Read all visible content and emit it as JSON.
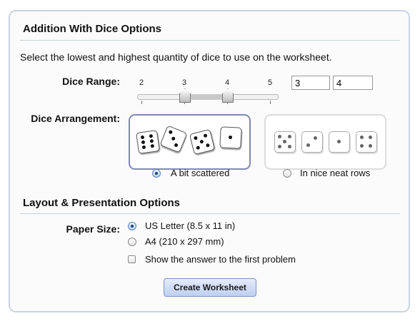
{
  "dice_section": {
    "title": "Addition With Dice Options",
    "intro": "Select the lowest and highest quantity of dice to use on the worksheet.",
    "range": {
      "label": "Dice Range:",
      "ticks": [
        "2",
        "3",
        "4",
        "5"
      ],
      "low_value": "3",
      "high_value": "4"
    },
    "arrangement": {
      "label": "Dice Arrangement:",
      "options": [
        {
          "label": "A bit scattered",
          "checked": true
        },
        {
          "label": "In nice neat rows",
          "checked": false
        }
      ]
    }
  },
  "layout_section": {
    "title": "Layout & Presentation Options",
    "paper_size": {
      "label": "Paper Size:",
      "options": [
        {
          "label": "US Letter (8.5 x 11 in)",
          "checked": true
        },
        {
          "label": "A4 (210 x 297 mm)",
          "checked": false
        }
      ]
    },
    "show_answer_label": "Show the answer to the first problem",
    "show_answer_checked": false
  },
  "create_button_label": "Create Worksheet",
  "colors": {
    "panel_border": "#c9d5e6",
    "selected_border": "#7f88b5",
    "button_bg": "#c8d6f3"
  }
}
